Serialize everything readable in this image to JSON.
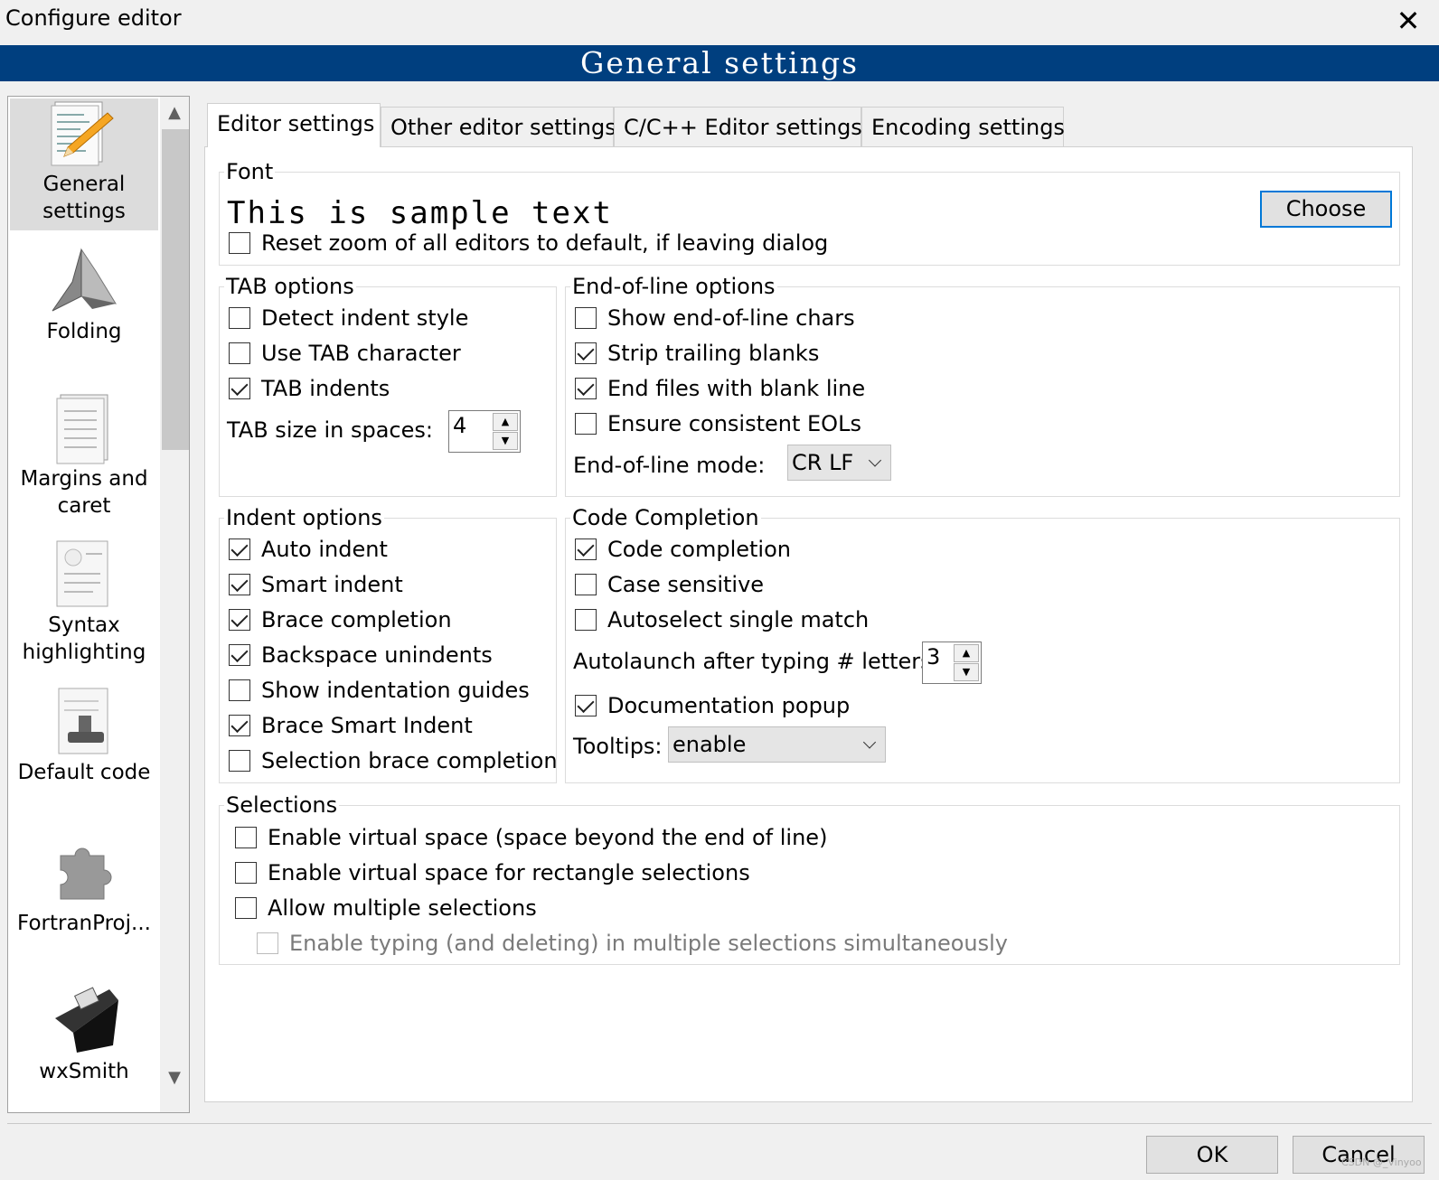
{
  "window": {
    "title": "Configure editor",
    "close": "✕"
  },
  "banner": {
    "title": "General settings"
  },
  "sidebar": {
    "items": [
      {
        "label": "General settings",
        "selected": true
      },
      {
        "label": "Folding"
      },
      {
        "label": "Margins and caret"
      },
      {
        "label": "Syntax highlighting"
      },
      {
        "label": "Default code"
      },
      {
        "label": "FortranProj..."
      },
      {
        "label": "wxSmith"
      }
    ],
    "scroll_up": "▲",
    "scroll_down": "▼"
  },
  "tabs": [
    "Editor settings",
    "Other editor settings",
    "C/C++ Editor settings",
    "Encoding settings"
  ],
  "font": {
    "legend": "Font",
    "sample": "This is sample text",
    "choose": "Choose",
    "reset_zoom": {
      "label": "Reset zoom of all editors to default, if leaving dialog",
      "checked": false
    }
  },
  "tab_options": {
    "legend": "TAB options",
    "items": [
      {
        "label": "Detect indent style",
        "checked": false
      },
      {
        "label": "Use TAB character",
        "checked": false
      },
      {
        "label": "TAB indents",
        "checked": true
      }
    ],
    "size_label": "TAB size in spaces:",
    "size_value": "4"
  },
  "eol_options": {
    "legend": "End-of-line options",
    "items": [
      {
        "label": "Show end-of-line chars",
        "checked": false
      },
      {
        "label": "Strip trailing blanks",
        "checked": true
      },
      {
        "label": "End files with blank line",
        "checked": true
      },
      {
        "label": "Ensure consistent EOLs",
        "checked": false
      }
    ],
    "mode_label": "End-of-line mode:",
    "mode_value": "CR LF"
  },
  "indent_options": {
    "legend": "Indent options",
    "items": [
      {
        "label": "Auto indent",
        "checked": true
      },
      {
        "label": "Smart indent",
        "checked": true
      },
      {
        "label": "Brace completion",
        "checked": true
      },
      {
        "label": "Backspace unindents",
        "checked": true
      },
      {
        "label": "Show indentation guides",
        "checked": false
      },
      {
        "label": "Brace Smart Indent",
        "checked": true
      },
      {
        "label": "Selection brace completion",
        "checked": false
      }
    ]
  },
  "code_completion": {
    "legend": "Code Completion",
    "items": [
      {
        "label": "Code completion",
        "checked": true
      },
      {
        "label": "Case sensitive",
        "checked": false
      },
      {
        "label": "Autoselect single match",
        "checked": false
      }
    ],
    "autolaunch_label": "Autolaunch after typing # letters:",
    "autolaunch_value": "3",
    "doc_popup": {
      "label": "Documentation popup",
      "checked": true
    },
    "tooltips_label": "Tooltips:",
    "tooltips_value": "enable"
  },
  "selections": {
    "legend": "Selections",
    "items": [
      {
        "label": "Enable virtual space (space beyond the end of line)",
        "checked": false
      },
      {
        "label": "Enable virtual space for rectangle selections",
        "checked": false
      },
      {
        "label": "Allow multiple selections",
        "checked": false
      }
    ],
    "typing_multi": {
      "label": "Enable typing (and deleting) in multiple selections simultaneously",
      "checked": false,
      "disabled": true
    }
  },
  "buttons": {
    "ok": "OK",
    "cancel": "Cancel"
  },
  "watermark": "CSDN @_Vinyoo",
  "colors": {
    "banner": "#003f7f",
    "accent": "#0078d7",
    "panel": "#ffffff",
    "window": "#f0f0f0"
  }
}
